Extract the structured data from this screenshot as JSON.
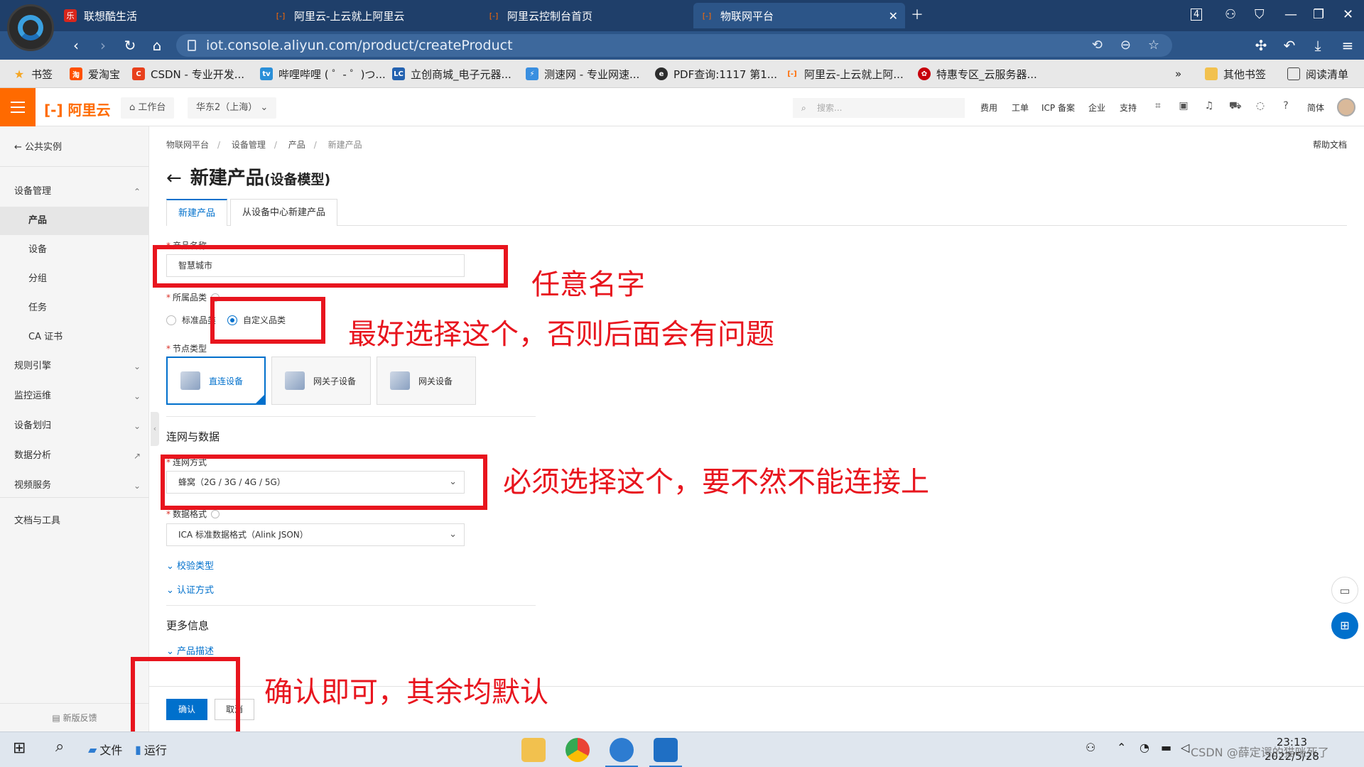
{
  "browser": {
    "tabs": [
      {
        "title": "联想酷生活",
        "icon_text": "乐"
      },
      {
        "title": "阿里云-上云就上阿里云",
        "icon_text": "[-]"
      },
      {
        "title": "阿里云控制台首页",
        "icon_text": "[-]"
      },
      {
        "title": "物联网平台",
        "icon_text": "[-]"
      }
    ],
    "tab_counter": "4",
    "address": "iot.console.aliyun.com/product/createProduct",
    "bookmarks": [
      {
        "label": "书签",
        "icon": "star-icon",
        "color": "#f5a623"
      },
      {
        "label": "爱淘宝",
        "icon": "taobao-icon",
        "color": "#ff5000"
      },
      {
        "label": "CSDN - 专业开发...",
        "icon": "csdn-icon",
        "color": "#e8401c"
      },
      {
        "label": "哔哩哔哩 ( ゜- ゜)つ...",
        "icon": "bilibili-icon",
        "color": "#2a8fd8"
      },
      {
        "label": "立创商城_电子元器...",
        "icon": "lc-icon",
        "color": "#2462b0"
      },
      {
        "label": "测速网 - 专业网速...",
        "icon": "speedtest-icon",
        "color": "#3a8fe0"
      },
      {
        "label": "PDF查询:1117 第1...",
        "icon": "edge-icon",
        "color": "#2d2d2d"
      },
      {
        "label": "阿里云-上云就上阿...",
        "icon": "aliyun-icon",
        "color": "#ff6a00"
      },
      {
        "label": "特惠专区_云服务器...",
        "icon": "huawei-icon",
        "color": "#c7000b"
      }
    ],
    "more_bookmarks": "»",
    "other_bookmarks": "其他书签",
    "reading_list": "阅读清单"
  },
  "console": {
    "logo": "阿里云",
    "workbench": "工作台",
    "region": "华东2（上海）",
    "search_placeholder": "搜索...",
    "links": [
      "费用",
      "工单",
      "ICP 备案",
      "企业",
      "支持"
    ],
    "lang": "简体"
  },
  "sidebar": {
    "back": "公共实例",
    "items": [
      {
        "label": "设备管理",
        "type": "group",
        "chev": "⌃"
      },
      {
        "label": "产品",
        "type": "sub",
        "active": true
      },
      {
        "label": "设备",
        "type": "sub"
      },
      {
        "label": "分组",
        "type": "sub"
      },
      {
        "label": "任务",
        "type": "sub"
      },
      {
        "label": "CA 证书",
        "type": "sub"
      },
      {
        "label": "规则引擎",
        "type": "group",
        "chev": "⌄"
      },
      {
        "label": "监控运维",
        "type": "group",
        "chev": "⌄"
      },
      {
        "label": "设备划归",
        "type": "group",
        "chev": "⌄"
      },
      {
        "label": "数据分析",
        "type": "group",
        "chev": "↗"
      },
      {
        "label": "视频服务",
        "type": "group",
        "chev": "⌄"
      },
      {
        "label": "文档与工具",
        "type": "group"
      }
    ],
    "feedback": "新版反馈"
  },
  "main": {
    "breadcrumb": [
      "物联网平台",
      "设备管理",
      "产品",
      "新建产品"
    ],
    "help": "帮助文档",
    "title": "新建产品",
    "title_suffix": "(设备模型)",
    "tabs": [
      "新建产品",
      "从设备中心新建产品"
    ],
    "form": {
      "name_label": "产品名称",
      "name_value": "智慧城市",
      "category_label": "所属品类",
      "category_options": [
        "标准品类",
        "自定义品类"
      ],
      "node_label": "节点类型",
      "node_options": [
        "直连设备",
        "网关子设备",
        "网关设备"
      ],
      "network_section": "连网与数据",
      "network_label": "连网方式",
      "network_value": "蜂窝（2G / 3G / 4G / 5G）",
      "data_label": "数据格式",
      "data_value": "ICA 标准数据格式（Alink JSON）",
      "verify": "校验类型",
      "auth": "认证方式",
      "more_section": "更多信息",
      "desc": "产品描述"
    },
    "confirm": "确认",
    "cancel": "取消"
  },
  "annotations": {
    "note1": "任意名字",
    "note2": "最好选择这个，否则后面会有问题",
    "note3": "必须选择这个，要不然不能连接上",
    "note4": "确认即可，其余均默认",
    "color": "#e8151e"
  },
  "taskbar": {
    "file": "文件",
    "run": "运行",
    "time": "23:13",
    "date": "2022/5/28",
    "watermark": "CSDN @薛定谔的猫咪死了"
  }
}
